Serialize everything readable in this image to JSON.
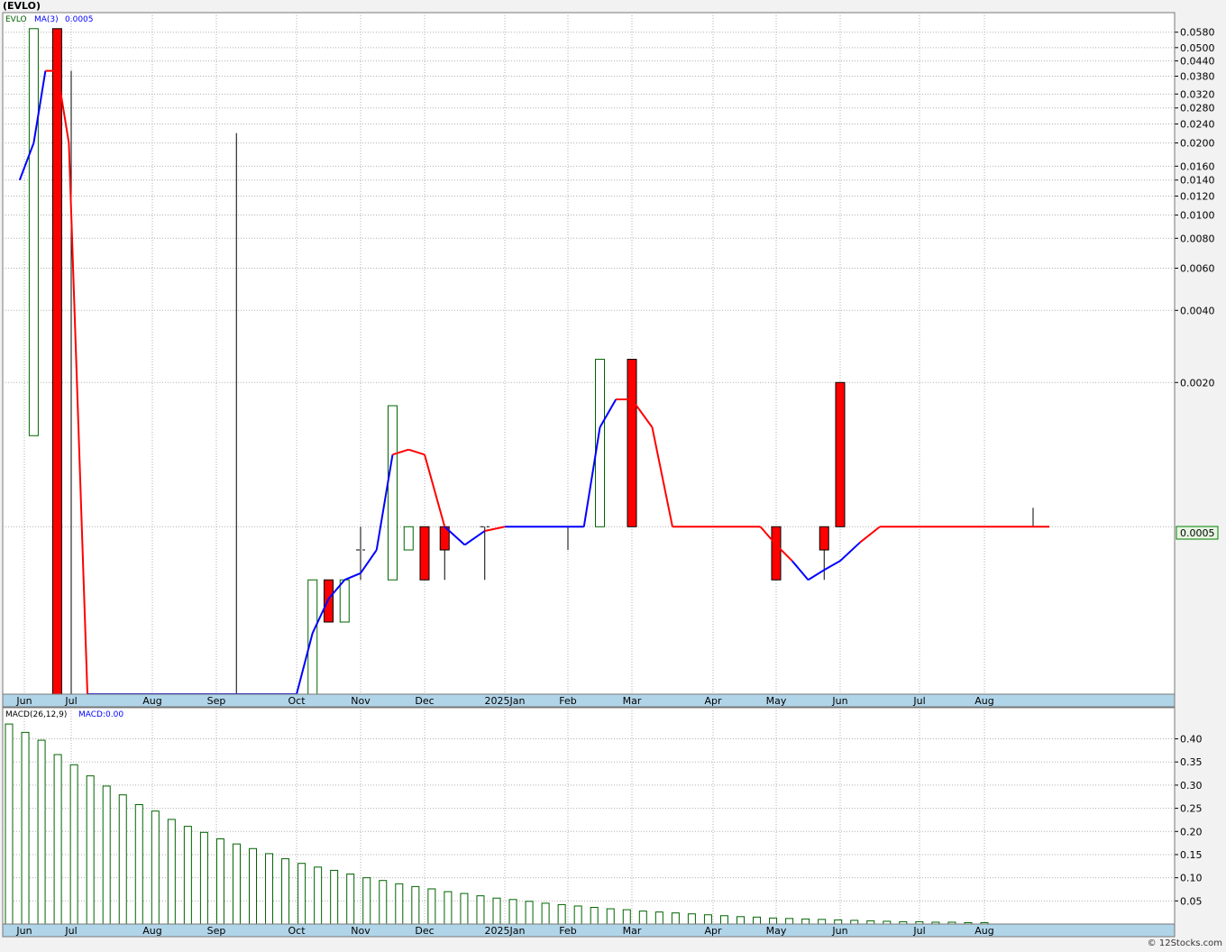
{
  "ticker_title": "(EVLO)",
  "credit": "© 12Stocks.com",
  "colors": {
    "up": "#006400",
    "down": "#ff0000",
    "ma": "#0000ff",
    "ma_down": "#ff0000",
    "last_price_bg": "#e8f5e2",
    "last_price_border": "#008000",
    "axis_bar": "#b0d4e8"
  },
  "price_legend": {
    "symbol": "EVLO",
    "ma_label": "MA(3)",
    "ma_value": "0.0005"
  },
  "macd_legend": {
    "label": "MACD(26,12,9)",
    "value_label": "MACD:0.00"
  },
  "last_price_label": "0.0005",
  "x_axis_labels": [
    "Jun",
    "Jul",
    "Aug",
    "Sep",
    "Oct",
    "Nov",
    "Dec",
    "2025Jan",
    "Feb",
    "Mar",
    "Apr",
    "May",
    "Jun",
    "Jul",
    "Aug"
  ],
  "chart_data": [
    {
      "type": "candlestick",
      "scale": "log",
      "y_ticks": [
        "0.0580",
        "0.0500",
        "0.0440",
        "0.0380",
        "0.0320",
        "0.0280",
        "0.0240",
        "0.0200",
        "0.0160",
        "0.0140",
        "0.0120",
        "0.0100",
        "0.0080",
        "0.0060",
        "0.0040",
        "0.0020",
        "0.0005"
      ],
      "ylim": [
        0.0001,
        0.062
      ],
      "grid": true,
      "candles": [
        {
          "month": 0.2,
          "open": 0.0012,
          "close": 0.06,
          "high": 0.06,
          "low": 0.0012,
          "dir": "up"
        },
        {
          "month": 0.7,
          "open": 0.06,
          "close": 0.0001,
          "high": 0.06,
          "low": 0.0001,
          "dir": "down"
        },
        {
          "month": 1.0,
          "open": 0.04,
          "close": 0.0001,
          "high": 0.04,
          "low": 0.0001,
          "dir": "line"
        },
        {
          "month": 3.25,
          "open": 0.022,
          "close": 0.0001,
          "high": 0.022,
          "low": 0.0001,
          "dir": "line"
        },
        {
          "month": 4.25,
          "open": 0.0001,
          "close": 0.0003,
          "high": 0.0003,
          "low": 0.0001,
          "dir": "up"
        },
        {
          "month": 4.5,
          "open": 0.0003,
          "close": 0.0002,
          "high": 0.0003,
          "low": 0.0002,
          "dir": "down"
        },
        {
          "month": 4.75,
          "open": 0.0002,
          "close": 0.0003,
          "high": 0.0003,
          "low": 0.0002,
          "dir": "up"
        },
        {
          "month": 5.0,
          "open": 0.0004,
          "close": 0.0004,
          "high": 0.0005,
          "low": 0.0003,
          "dir": "doji"
        },
        {
          "month": 5.5,
          "open": 0.0003,
          "close": 0.0016,
          "high": 0.0016,
          "low": 0.0003,
          "dir": "up"
        },
        {
          "month": 5.75,
          "open": 0.0004,
          "close": 0.0005,
          "high": 0.0005,
          "low": 0.0004,
          "dir": "up"
        },
        {
          "month": 6.0,
          "open": 0.0005,
          "close": 0.0003,
          "high": 0.0005,
          "low": 0.0003,
          "dir": "down"
        },
        {
          "month": 6.25,
          "open": 0.0005,
          "close": 0.0004,
          "high": 0.0005,
          "low": 0.0003,
          "dir": "down"
        },
        {
          "month": 6.75,
          "open": 0.0005,
          "close": 0.0005,
          "high": 0.0005,
          "low": 0.0003,
          "dir": "doji"
        },
        {
          "month": 8.0,
          "open": 0.0005,
          "close": 0.0005,
          "high": 0.0005,
          "low": 0.0004,
          "dir": "doji"
        },
        {
          "month": 8.5,
          "open": 0.0005,
          "close": 0.0025,
          "high": 0.0025,
          "low": 0.0005,
          "dir": "up"
        },
        {
          "month": 9.0,
          "open": 0.0025,
          "close": 0.0005,
          "high": 0.0025,
          "low": 0.0005,
          "dir": "down"
        },
        {
          "month": 11.0,
          "open": 0.0005,
          "close": 0.0003,
          "high": 0.0005,
          "low": 0.0003,
          "dir": "down"
        },
        {
          "month": 11.75,
          "open": 0.0005,
          "close": 0.0004,
          "high": 0.0005,
          "low": 0.0003,
          "dir": "down"
        },
        {
          "month": 12.0,
          "open": 0.002,
          "close": 0.0005,
          "high": 0.002,
          "low": 0.0005,
          "dir": "down"
        },
        {
          "month": 14.75,
          "open": 0.0005,
          "close": 0.0005,
          "high": 0.0006,
          "low": 0.0005,
          "dir": "doji"
        }
      ],
      "ma_series": {
        "name": "MA(3)",
        "points": [
          [
            -0.1,
            0.014,
            "up"
          ],
          [
            0.2,
            0.02,
            "up"
          ],
          [
            0.45,
            0.04,
            "up"
          ],
          [
            0.7,
            0.04,
            "down"
          ],
          [
            0.95,
            0.02,
            "down"
          ],
          [
            1.2,
            0.0001,
            "down"
          ],
          [
            4.0,
            0.0001,
            "up"
          ],
          [
            4.25,
            0.00018,
            "up"
          ],
          [
            4.5,
            0.00025,
            "up"
          ],
          [
            4.75,
            0.0003,
            "up"
          ],
          [
            5.0,
            0.00032,
            "up"
          ],
          [
            5.25,
            0.0004,
            "up"
          ],
          [
            5.5,
            0.001,
            "up"
          ],
          [
            5.75,
            0.00105,
            "down"
          ],
          [
            6.0,
            0.001,
            "down"
          ],
          [
            6.25,
            0.0005,
            "down"
          ],
          [
            6.5,
            0.00042,
            "up"
          ],
          [
            6.75,
            0.00048,
            "up"
          ],
          [
            7.0,
            0.0005,
            "down"
          ],
          [
            8.25,
            0.0005,
            "up"
          ],
          [
            8.5,
            0.0013,
            "up"
          ],
          [
            8.75,
            0.0017,
            "up"
          ],
          [
            9.0,
            0.0017,
            "down"
          ],
          [
            9.25,
            0.0013,
            "down"
          ],
          [
            9.5,
            0.0005,
            "down"
          ],
          [
            10.75,
            0.0005,
            "down"
          ],
          [
            11.0,
            0.00042,
            "down"
          ],
          [
            11.25,
            0.00036,
            "down"
          ],
          [
            11.5,
            0.0003,
            "up"
          ],
          [
            11.75,
            0.00033,
            "up"
          ],
          [
            12.0,
            0.00036,
            "up"
          ],
          [
            12.25,
            0.00043,
            "up"
          ],
          [
            12.5,
            0.0005,
            "down"
          ],
          [
            15.0,
            0.0005,
            "down"
          ]
        ]
      }
    },
    {
      "type": "bar",
      "title": "MACD(26,12,9)",
      "y_ticks": [
        "0.40",
        "0.35",
        "0.30",
        "0.25",
        "0.20",
        "0.15",
        "0.10",
        "0.05"
      ],
      "ylim": [
        0.0,
        0.44
      ],
      "grid": true,
      "series": [
        {
          "name": "MACD",
          "values": [
            0.432,
            0.414,
            0.397,
            0.366,
            0.344,
            0.32,
            0.298,
            0.279,
            0.258,
            0.244,
            0.226,
            0.211,
            0.198,
            0.184,
            0.173,
            0.163,
            0.152,
            0.141,
            0.131,
            0.123,
            0.116,
            0.108,
            0.1,
            0.094,
            0.087,
            0.081,
            0.076,
            0.07,
            0.066,
            0.061,
            0.056,
            0.053,
            0.049,
            0.045,
            0.042,
            0.039,
            0.036,
            0.033,
            0.031,
            0.028,
            0.026,
            0.024,
            0.022,
            0.02,
            0.018,
            0.016,
            0.015,
            0.013,
            0.012,
            0.011,
            0.01,
            0.009,
            0.008,
            0.007,
            0.006,
            0.005,
            0.005,
            0.004,
            0.004,
            0.003,
            0.003
          ]
        }
      ]
    }
  ]
}
